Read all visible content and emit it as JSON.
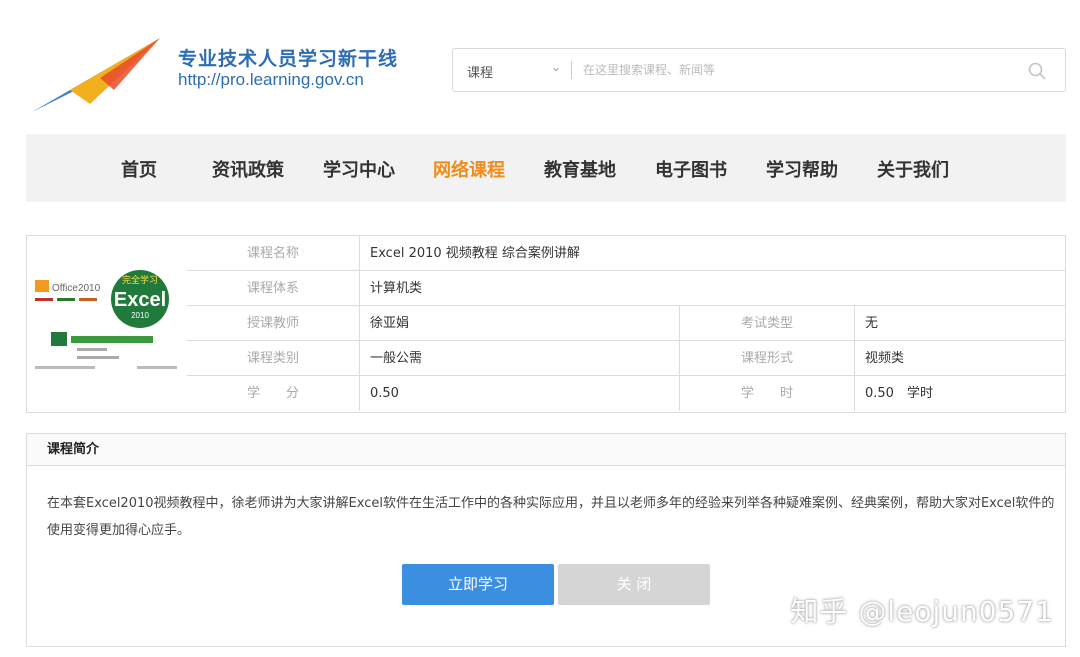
{
  "header": {
    "site_title": "专业技术人员学习新干线",
    "site_url": "http://pro.learning.gov.cn"
  },
  "search": {
    "category": "课程",
    "placeholder": "在这里搜索课程、新闻等"
  },
  "nav": {
    "items": [
      {
        "label": "首页",
        "active": false
      },
      {
        "label": "资讯政策",
        "active": false
      },
      {
        "label": "学习中心",
        "active": false
      },
      {
        "label": "网络课程",
        "active": true
      },
      {
        "label": "教育基地",
        "active": false
      },
      {
        "label": "电子图书",
        "active": false
      },
      {
        "label": "学习帮助",
        "active": false
      },
      {
        "label": "关于我们",
        "active": false
      }
    ]
  },
  "course": {
    "thumbnail": {
      "brand": "Office2010",
      "title": "Excel",
      "tag": "完全学习",
      "year": "2010"
    },
    "name_label": "课程名称",
    "name": "Excel 2010 视频教程 综合案例讲解",
    "system_label": "课程体系",
    "system": "计算机类",
    "teacher_label": "授课教师",
    "teacher": "徐亚娟",
    "exam_type_label": "考试类型",
    "exam_type": "无",
    "category_label": "课程类别",
    "category": "一般公需",
    "format_label": "课程形式",
    "format": "视频类",
    "credit_label": "学　　分",
    "credit": "0.50",
    "hours_label": "学　　时",
    "hours": "0.50　学时"
  },
  "intro": {
    "heading": "课程简介",
    "text": "在本套Excel2010视频教程中，徐老师讲为大家讲解Excel软件在生活工作中的各种实际应用，并且以老师多年的经验来列举各种疑难案例、经典案例，帮助大家对Excel软件的使用变得更加得心应手。",
    "study_button": "立即学习",
    "close_button": "关 闭"
  },
  "watermark": "知乎 @leojun0571",
  "colors": {
    "brand_blue": "#2d6db5",
    "nav_active": "#f08c1a",
    "button_blue": "#3b8ee0",
    "button_gray": "#d5d5d5"
  }
}
